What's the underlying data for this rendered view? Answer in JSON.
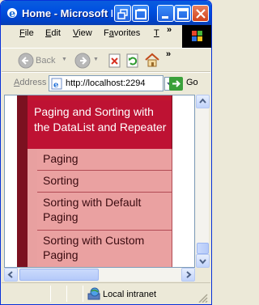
{
  "window": {
    "title": "Home - Microsoft Internet Explorer"
  },
  "menu": {
    "items": [
      {
        "label": "File",
        "key": "F",
        "rest": "ile"
      },
      {
        "label": "Edit",
        "key": "E",
        "rest": "dit"
      },
      {
        "label": "View",
        "key": "V",
        "rest": "iew"
      },
      {
        "label": "Favorites",
        "key": "a",
        "pre": "F",
        "rest": "vorites"
      },
      {
        "label": "T",
        "key": "T",
        "rest": ""
      }
    ],
    "overflow": "»"
  },
  "toolbar": {
    "back_label": "Back",
    "overflow": "»"
  },
  "address": {
    "label": "Address",
    "url": "http://localhost:2294",
    "go_label": "Go"
  },
  "page": {
    "header": "Paging and Sorting with the DataList and Repeater",
    "items": [
      "Paging",
      "Sorting",
      "Sorting with Default Paging",
      "Sorting with Custom Paging"
    ]
  },
  "status": {
    "zone": "Local intranet"
  },
  "colors": {
    "header_bg": "#BE1233",
    "item_bg": "#EAA1A1",
    "strip": "#7B1120",
    "titlebar": "#0050E0"
  }
}
